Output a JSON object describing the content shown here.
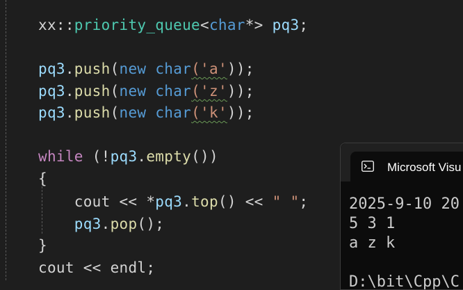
{
  "editor": {
    "lines": [
      {
        "id": "l1",
        "tokens": [
          {
            "t": "xx",
            "c": "ns"
          },
          {
            "t": "::",
            "c": "pun"
          },
          {
            "t": "priority_queue",
            "c": "typ"
          },
          {
            "t": "<",
            "c": "pun"
          },
          {
            "t": "char",
            "c": "kw"
          },
          {
            "t": "*> ",
            "c": "pun"
          },
          {
            "t": "pq3",
            "c": "var"
          },
          {
            "t": ";",
            "c": "pun"
          }
        ]
      },
      {
        "id": "l2",
        "tokens": [
          {
            "t": "pq3",
            "c": "var"
          },
          {
            "t": ".",
            "c": "pun"
          },
          {
            "t": "push",
            "c": "fn"
          },
          {
            "t": "(",
            "c": "pun"
          },
          {
            "t": "new",
            "c": "kw"
          },
          {
            "t": " ",
            "c": "pun"
          },
          {
            "t": "char",
            "c": "kw"
          },
          {
            "t": "('a'",
            "c": "str squig"
          },
          {
            "t": "));",
            "c": "pun"
          }
        ]
      },
      {
        "id": "l3",
        "tokens": [
          {
            "t": "pq3",
            "c": "var"
          },
          {
            "t": ".",
            "c": "pun"
          },
          {
            "t": "push",
            "c": "fn"
          },
          {
            "t": "(",
            "c": "pun"
          },
          {
            "t": "new",
            "c": "kw"
          },
          {
            "t": " ",
            "c": "pun"
          },
          {
            "t": "char",
            "c": "kw"
          },
          {
            "t": "('z'",
            "c": "str squig"
          },
          {
            "t": "));",
            "c": "pun"
          }
        ]
      },
      {
        "id": "l4",
        "tokens": [
          {
            "t": "pq3",
            "c": "var"
          },
          {
            "t": ".",
            "c": "pun"
          },
          {
            "t": "push",
            "c": "fn"
          },
          {
            "t": "(",
            "c": "pun"
          },
          {
            "t": "new",
            "c": "kw"
          },
          {
            "t": " ",
            "c": "pun"
          },
          {
            "t": "char",
            "c": "kw"
          },
          {
            "t": "('k'",
            "c": "str squig"
          },
          {
            "t": "));",
            "c": "pun"
          }
        ]
      },
      {
        "id": "l5",
        "tokens": [
          {
            "t": "while",
            "c": "ctl"
          },
          {
            "t": " (!",
            "c": "pun"
          },
          {
            "t": "pq3",
            "c": "var"
          },
          {
            "t": ".",
            "c": "pun"
          },
          {
            "t": "empty",
            "c": "fn"
          },
          {
            "t": "())",
            "c": "pun"
          }
        ]
      },
      {
        "id": "l6",
        "tokens": [
          {
            "t": "{",
            "c": "pun"
          }
        ]
      },
      {
        "id": "l7",
        "tokens": [
          {
            "t": "    cout",
            "c": "ns"
          },
          {
            "t": " << *",
            "c": "pun"
          },
          {
            "t": "pq3",
            "c": "var"
          },
          {
            "t": ".",
            "c": "pun"
          },
          {
            "t": "top",
            "c": "fn"
          },
          {
            "t": "() << ",
            "c": "pun"
          },
          {
            "t": "\" \"",
            "c": "str"
          },
          {
            "t": ";",
            "c": "pun"
          }
        ]
      },
      {
        "id": "l8",
        "tokens": [
          {
            "t": "    pq3",
            "c": "var"
          },
          {
            "t": ".",
            "c": "pun"
          },
          {
            "t": "pop",
            "c": "fn"
          },
          {
            "t": "();",
            "c": "pun"
          }
        ]
      },
      {
        "id": "l9",
        "tokens": [
          {
            "t": "}",
            "c": "pun"
          }
        ]
      },
      {
        "id": "l10",
        "tokens": [
          {
            "t": "cout",
            "c": "ns"
          },
          {
            "t": " << ",
            "c": "pun"
          },
          {
            "t": "endl",
            "c": "ns"
          },
          {
            "t": ";",
            "c": "pun"
          }
        ]
      }
    ]
  },
  "console": {
    "title": "Microsoft Visu",
    "icon": "terminal-icon",
    "output": [
      "2025-9-10 20",
      "5 3 1",
      "a z k",
      "",
      "D:\\bit\\Cpp\\C"
    ]
  },
  "colors": {
    "background": "#1e1e1e",
    "keyword": "#569cd6",
    "type": "#4ec9b0",
    "function": "#dcdcaa",
    "variable": "#9cdcfe",
    "string": "#ce9178",
    "control": "#c586c0",
    "console_bg": "#0c0c0c"
  }
}
